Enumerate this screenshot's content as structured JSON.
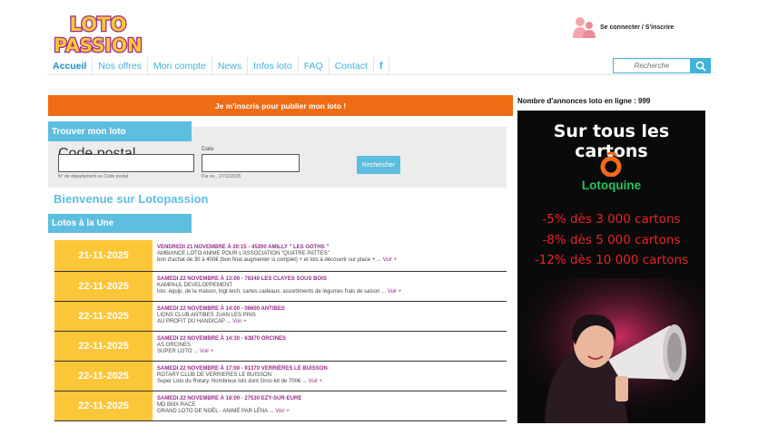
{
  "header": {
    "logo_line1": "LOTO",
    "logo_line2": "PASSION",
    "login_label": "Se connecter / S'inscrire"
  },
  "nav": {
    "items": [
      "Accueil",
      "Nos offres",
      "Mon compte",
      "News",
      "Infos loto",
      "FAQ",
      "Contact"
    ],
    "facebook": "f",
    "search_placeholder": "Recherche"
  },
  "cta_label": "Je m'inscris pour publier mon loto !",
  "ads_count_label": "Nombre d'annonces loto en ligne : 999",
  "find": {
    "title": "Trouver mon loto",
    "postal_label": "Code postal",
    "postal_hint": "N° de département ou Code postal",
    "date_label": "Date",
    "date_hint": "Par ex., 17/11/2025",
    "search_button": "Rechercher"
  },
  "welcome": "Bienvenue sur Lotopassion",
  "une_title": "Lotos à la Une",
  "lotos": [
    {
      "date": "21-11-2025",
      "title": "VENDREDI 21 NOVEMBRE À 20:15 - 45200 AMILLY \" LES GOTHS \"",
      "org": "AMBIANCE LOTO ANIME POUR L'ASSOCIATION \"QUATRE PATTES\"",
      "desc": "bon d'achat de 30 à 400€ (bon final augmenter si complet) + et lots à découvrir sur place + ...",
      "more": "Voir +"
    },
    {
      "date": "22-11-2025",
      "title": "SAMEDI 22 NOVEMBRE À 13:00 - 78340 LES CLAYES SOUS BOIS",
      "org": "KAMPAUL DEVELOPPEMENT",
      "desc": "lots: équip. de la maison, higt-tech, cartes cadeaux, assortiments de légumes frais de saison ...",
      "more": "Voir +"
    },
    {
      "date": "22-11-2025",
      "title": "SAMEDI 22 NOVEMBRE À 14:00 - 06600 ANTIBES",
      "org": "LIONS CLUB ANTIBES JUAN LES PINS",
      "desc": "AU PROFIT DU HANDICAP ...",
      "more": "Voir +"
    },
    {
      "date": "22-11-2025",
      "title": "SAMEDI 22 NOVEMBRE À 14:30 - 63870 ORCINES",
      "org": "AS ORCINES",
      "desc": "SUPER LOTO ...",
      "more": "Voir +"
    },
    {
      "date": "22-11-2025",
      "title": "SAMEDI 22 NOVEMBRE À 17:00 - 91370 VERRIÈRES LE BUISSON",
      "org": "ROTARY CLUB DE VERRIERES LE BUISSON",
      "desc": "Super Loto du Rotary. Nombreux lots dont Gros-lot de 700€ ...",
      "more": "Voir +"
    },
    {
      "date": "22-11-2025",
      "title": "SAMEDI 22 NOVEMBRE À 18:00 - 27530 EZY-SUR-EURE",
      "org": "MD BMX RACE",
      "desc": "GRAND LOTO DE NOËL - ANIMÉ PAR LÉNA ...",
      "more": "Voir +"
    }
  ],
  "promo": {
    "title": "Sur tous les cartons",
    "brand": "Lotoquine",
    "lines": [
      "-5% dès 3 000 cartons",
      "-8% dès 5 000 cartons",
      "-12% dès 10 000 cartons"
    ]
  },
  "colors": {
    "accent": "#5dbedf",
    "cta": "#ee6c14",
    "date_badge": "#fbc638",
    "title_purple": "#9b2c8b"
  }
}
